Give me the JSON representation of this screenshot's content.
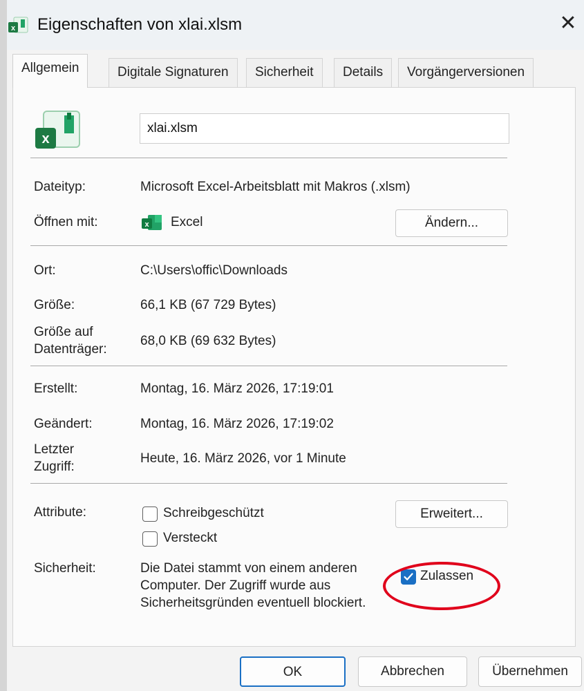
{
  "window": {
    "title": "Eigenschaften von xlai.xlsm",
    "close_glyph": "✕"
  },
  "tabs": [
    {
      "label": "Allgemein",
      "active": true
    },
    {
      "label": "Digitale Signaturen",
      "active": false
    },
    {
      "label": "Sicherheit",
      "active": false
    },
    {
      "label": "Details",
      "active": false
    },
    {
      "label": "Vorgängerversionen",
      "active": false
    }
  ],
  "general": {
    "file_icon": "excel-file-icon",
    "filename": "xlai.xlsm",
    "filetype_label": "Dateityp:",
    "filetype_value": "Microsoft Excel-Arbeitsblatt mit Makros (.xlsm)",
    "openwith_label": "Öffnen mit:",
    "openwith_app": "Excel",
    "openwith_icon": "excel-app-icon",
    "change_button": "Ändern...",
    "location_label": "Ort:",
    "location_value": "C:\\Users\\offic\\Downloads",
    "size_label": "Größe:",
    "size_value": "66,1 KB (67 729 Bytes)",
    "size_on_disk_label_1": "Größe auf",
    "size_on_disk_label_2": "Datenträger:",
    "size_on_disk_value": "68,0 KB (69 632 Bytes)",
    "created_label": "Erstellt:",
    "created_value": "Montag, 16. März 2026, 17:19:01",
    "modified_label": "Geändert:",
    "modified_value": "Montag, 16. März 2026, 17:19:02",
    "accessed_label_1": "Letzter",
    "accessed_label_2": "Zugriff:",
    "accessed_value": "Heute, 16. März 2026, vor 1 Minute",
    "attributes_label": "Attribute:",
    "readonly_label": "Schreibgeschützt",
    "readonly_checked": false,
    "hidden_label": "Versteckt",
    "hidden_checked": false,
    "advanced_button": "Erweitert...",
    "security_label": "Sicherheit:",
    "security_text": "Die Datei stammt von einem anderen Computer. Der Zugriff wurde aus Sicherheitsgründen eventuell blockiert.",
    "unblock_label": "Zulassen",
    "unblock_checked": true
  },
  "footer": {
    "ok": "OK",
    "cancel": "Abbrechen",
    "apply": "Übernehmen"
  },
  "colors": {
    "accent": "#1a6fc4",
    "annotation": "#e0001b",
    "excel_green": "#1d7a43"
  }
}
